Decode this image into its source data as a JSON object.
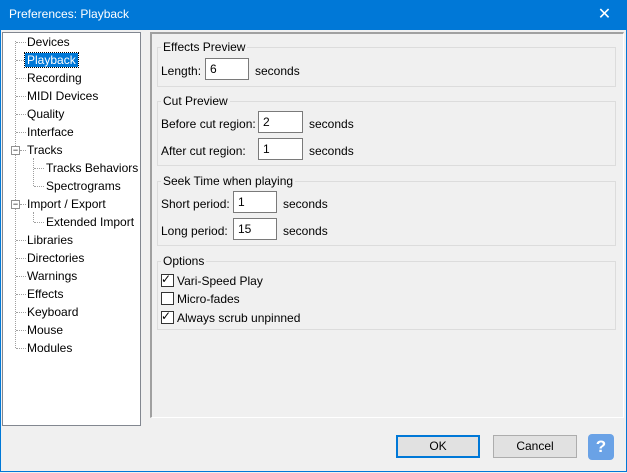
{
  "window": {
    "title": "Preferences: Playback",
    "close_glyph": "✕"
  },
  "tree": {
    "items": [
      {
        "label": "Devices"
      },
      {
        "label": "Playback"
      },
      {
        "label": "Recording"
      },
      {
        "label": "MIDI Devices"
      },
      {
        "label": "Quality"
      },
      {
        "label": "Interface"
      },
      {
        "label": "Tracks"
      },
      {
        "label": "Tracks Behaviors"
      },
      {
        "label": "Spectrograms"
      },
      {
        "label": "Import / Export"
      },
      {
        "label": "Extended Import"
      },
      {
        "label": "Libraries"
      },
      {
        "label": "Directories"
      },
      {
        "label": "Warnings"
      },
      {
        "label": "Effects"
      },
      {
        "label": "Keyboard"
      },
      {
        "label": "Mouse"
      },
      {
        "label": "Modules"
      }
    ],
    "selected": "Playback",
    "expander_glyph": "−"
  },
  "effects_preview": {
    "title": "Effects Preview",
    "length_label": "Length:",
    "length_value": "6",
    "length_unit": "seconds"
  },
  "cut_preview": {
    "title": "Cut Preview",
    "before_label": "Before cut region:",
    "before_value": "2",
    "before_unit": "seconds",
    "after_label": "After cut region:",
    "after_value": "1",
    "after_unit": "seconds"
  },
  "seek_time": {
    "title": "Seek Time when playing",
    "short_label": "Short period:",
    "short_value": "1",
    "short_unit": "seconds",
    "long_label": "Long period:",
    "long_value": "15",
    "long_unit": "seconds"
  },
  "options": {
    "title": "Options",
    "vari_speed_label": "Vari-Speed Play",
    "vari_speed_checked": true,
    "micro_fades_label": "Micro-fades",
    "micro_fades_checked": false,
    "always_scrub_label": "Always scrub unpinned",
    "always_scrub_checked": true,
    "check_glyph": "✓"
  },
  "buttons": {
    "ok": "OK",
    "cancel": "Cancel",
    "help": "?"
  },
  "colors": {
    "accent": "#0078d7",
    "help_button": "#6aa2e6"
  }
}
